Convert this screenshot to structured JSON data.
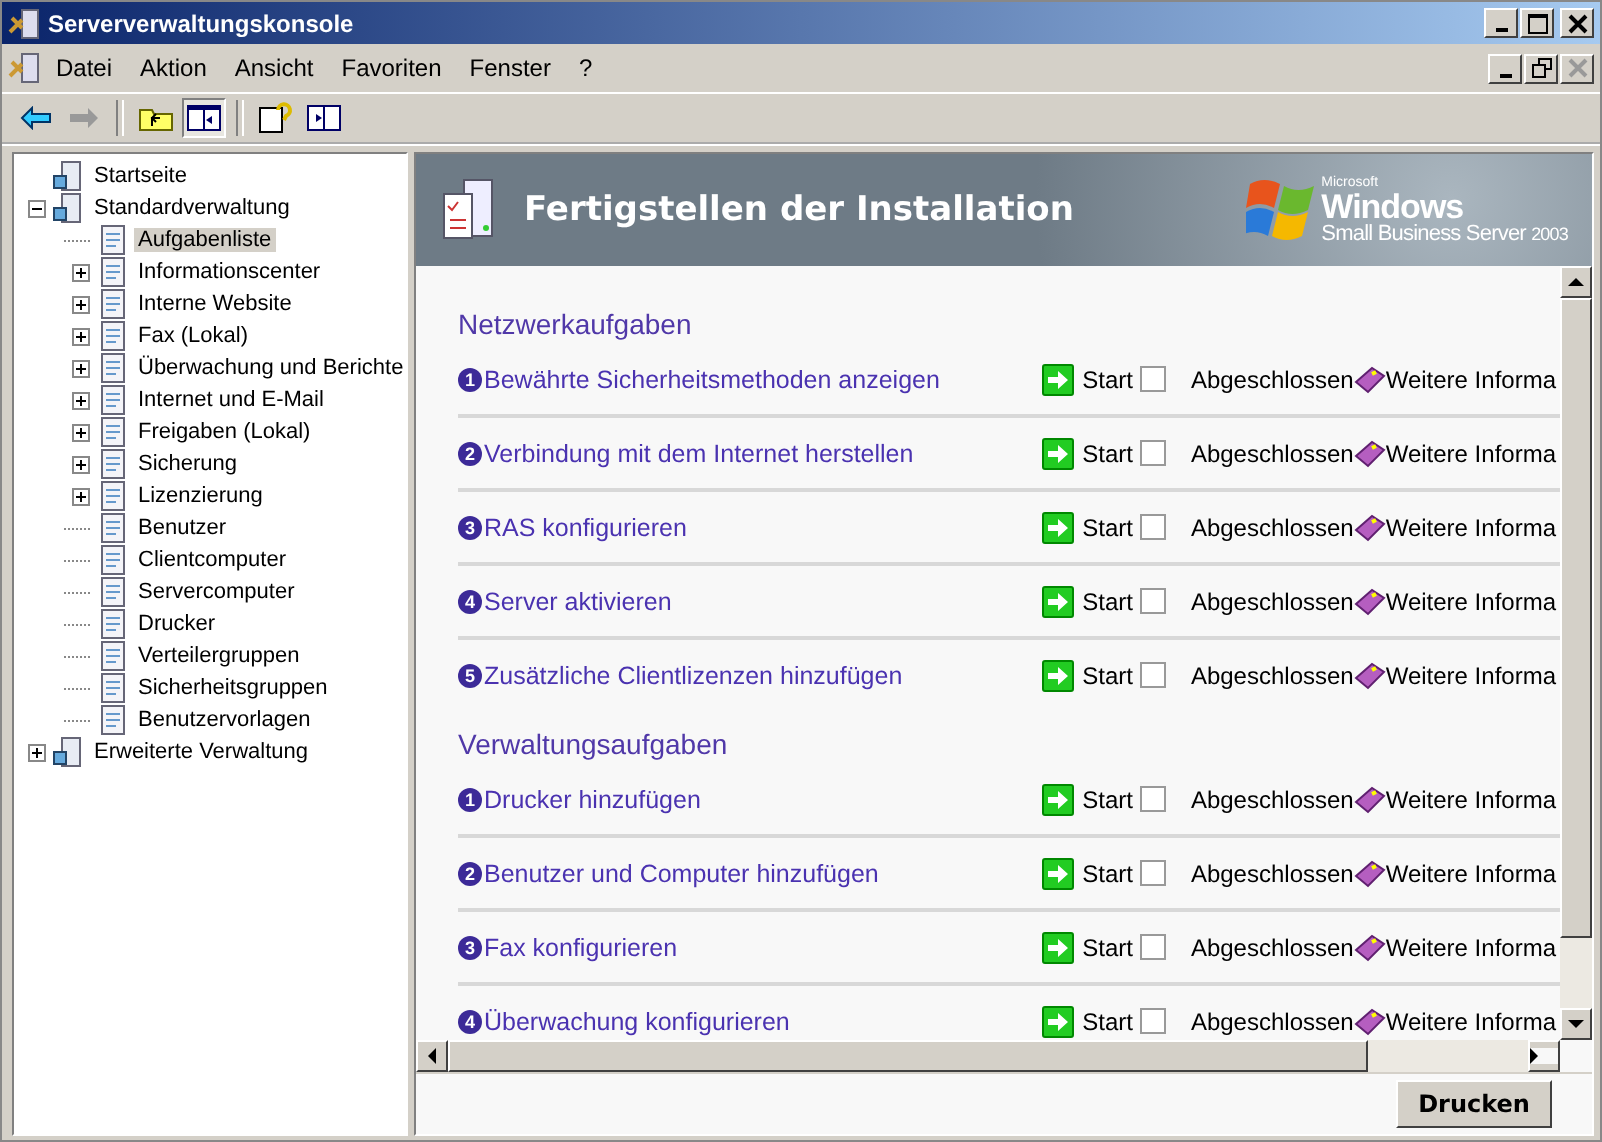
{
  "window": {
    "title": "Serververwaltungskonsole"
  },
  "menu": [
    "Datei",
    "Aktion",
    "Ansicht",
    "Favoriten",
    "Fenster",
    "?"
  ],
  "tree": [
    {
      "label": "Startseite",
      "selected": false
    },
    {
      "label": "Standardverwaltung",
      "selected": false,
      "expanded": true,
      "children": [
        {
          "label": "Aufgabenliste",
          "selected": true
        },
        {
          "label": "Informationscenter",
          "selected": false,
          "expanded": false
        },
        {
          "label": "Interne Website",
          "selected": false,
          "expanded": false
        },
        {
          "label": "Fax (Lokal)",
          "selected": false,
          "expanded": false
        },
        {
          "label": "Überwachung und Berichte",
          "selected": false,
          "expanded": false
        },
        {
          "label": "Internet und E-Mail",
          "selected": false,
          "expanded": false
        },
        {
          "label": "Freigaben (Lokal)",
          "selected": false,
          "expanded": false
        },
        {
          "label": "Sicherung",
          "selected": false,
          "expanded": false
        },
        {
          "label": "Lizenzierung",
          "selected": false,
          "expanded": false
        },
        {
          "label": "Benutzer",
          "selected": false
        },
        {
          "label": "Clientcomputer",
          "selected": false
        },
        {
          "label": "Servercomputer",
          "selected": false
        },
        {
          "label": "Drucker",
          "selected": false
        },
        {
          "label": "Verteilergruppen",
          "selected": false
        },
        {
          "label": "Sicherheitsgruppen",
          "selected": false
        },
        {
          "label": "Benutzervorlagen",
          "selected": false
        }
      ]
    },
    {
      "label": "Erweiterte Verwaltung",
      "selected": false,
      "expanded": false
    }
  ],
  "banner": {
    "title": "Fertigstellen der Installation",
    "logo_small": "Microsoft",
    "logo_big": "Windows",
    "logo_product": "Small Business Server",
    "logo_year": "2003"
  },
  "sections": [
    {
      "heading": "Netzwerkaufgaben",
      "tasks": [
        {
          "num": "1",
          "label": "Bewährte Sicherheitsmethoden anzeigen",
          "start": "Start",
          "checked": false,
          "done": "Abgeschlossen",
          "more": "Weitere Informa"
        },
        {
          "num": "2",
          "label": "Verbindung mit dem Internet herstellen",
          "start": "Start",
          "checked": false,
          "done": "Abgeschlossen",
          "more": "Weitere Informa"
        },
        {
          "num": "3",
          "label": "RAS konfigurieren",
          "start": "Start",
          "checked": false,
          "done": "Abgeschlossen",
          "more": "Weitere Informa"
        },
        {
          "num": "4",
          "label": "Server aktivieren",
          "start": "Start",
          "checked": false,
          "done": "Abgeschlossen",
          "more": "Weitere Informa"
        },
        {
          "num": "5",
          "label": "Zusätzliche Clientlizenzen hinzufügen",
          "start": "Start",
          "checked": false,
          "done": "Abgeschlossen",
          "more": "Weitere Informa"
        }
      ]
    },
    {
      "heading": "Verwaltungsaufgaben",
      "tasks": [
        {
          "num": "1",
          "label": "Drucker hinzufügen",
          "start": "Start",
          "checked": false,
          "done": "Abgeschlossen",
          "more": "Weitere Informa"
        },
        {
          "num": "2",
          "label": "Benutzer und Computer hinzufügen",
          "start": "Start",
          "checked": false,
          "done": "Abgeschlossen",
          "more": "Weitere Informa"
        },
        {
          "num": "3",
          "label": "Fax konfigurieren",
          "start": "Start",
          "checked": false,
          "done": "Abgeschlossen",
          "more": "Weitere Informa"
        },
        {
          "num": "4",
          "label": "Überwachung konfigurieren",
          "start": "Start",
          "checked": false,
          "done": "Abgeschlossen",
          "more": "Weitere Informa"
        }
      ]
    }
  ],
  "print_button": "Drucken"
}
